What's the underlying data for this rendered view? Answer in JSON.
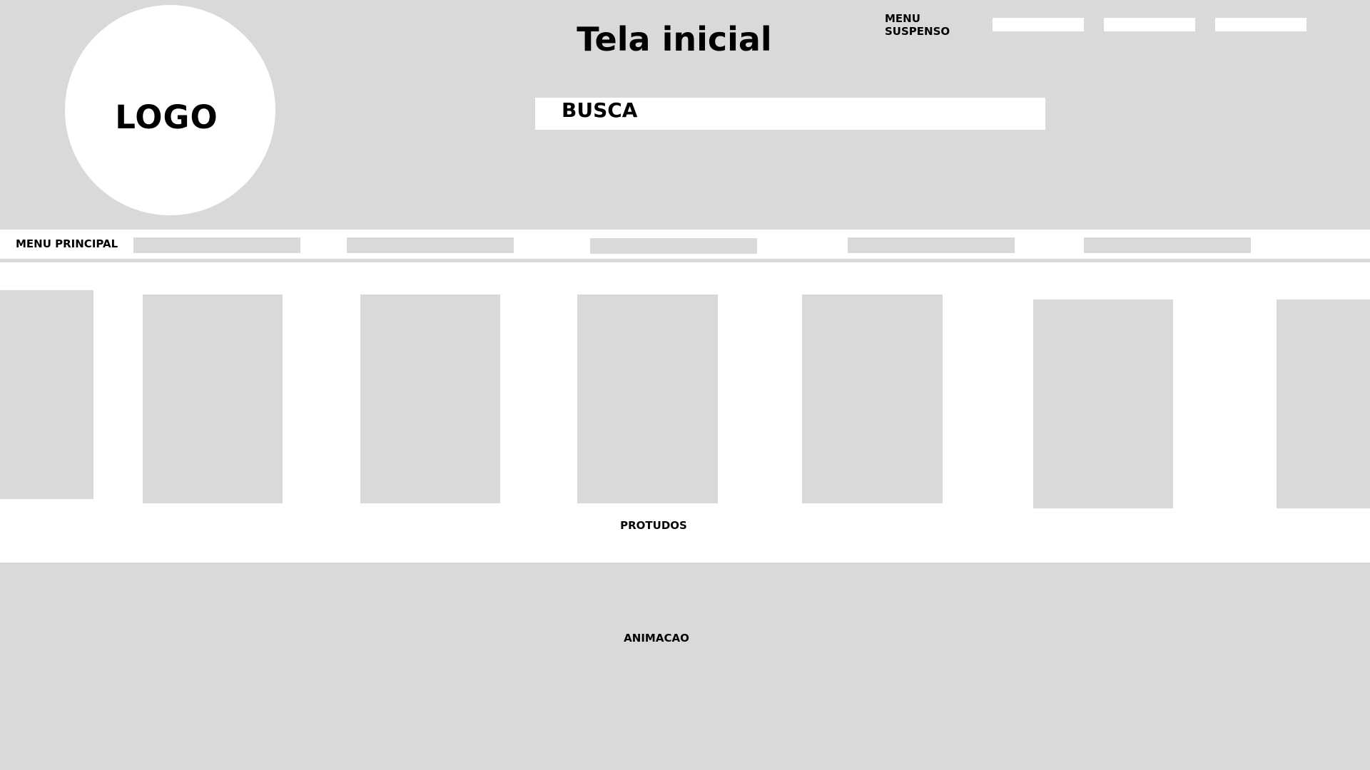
{
  "header": {
    "logo_text": "LOGO",
    "title": "Tela inicial",
    "dropdown_menu_label": "MENU SUSPENSO",
    "search_label": "BUSCA"
  },
  "main_menu": {
    "label": "MENU PRINCIPAL"
  },
  "products": {
    "label": "PROTUDOS"
  },
  "animation": {
    "label": "ANIMACAO"
  },
  "colors": {
    "placeholder_gray": "#d9d9d9",
    "background_white": "#ffffff",
    "text": "#000000"
  }
}
